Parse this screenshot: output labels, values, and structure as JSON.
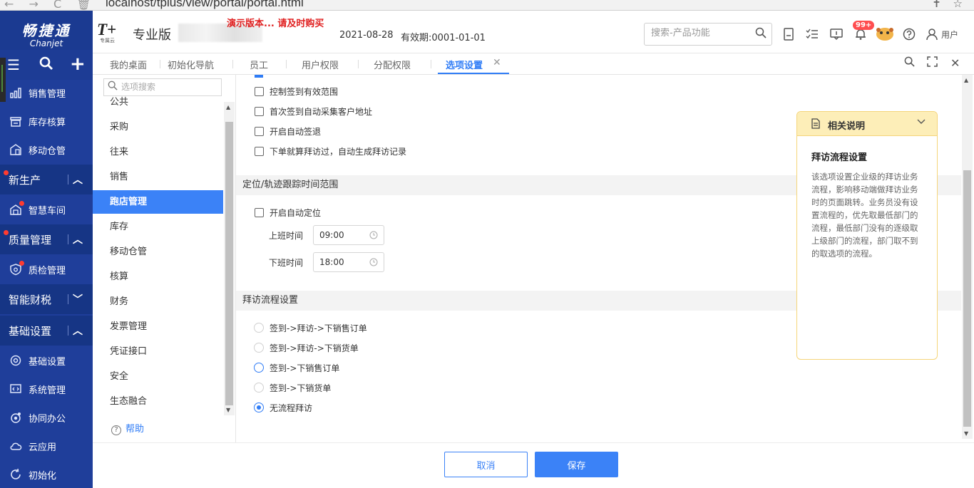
{
  "browser": {
    "url": "localhost/tplus/view/portal/portal.html"
  },
  "sidebar": {
    "logo_cn": "畅捷通",
    "logo_en": "Chanjet",
    "items": [
      {
        "label": "销售管理",
        "icon": "chart-icon"
      },
      {
        "label": "库存核算",
        "icon": "warehouse-icon"
      },
      {
        "label": "移动仓管",
        "icon": "mobile-warehouse-icon"
      },
      {
        "label": "新生产",
        "type": "group"
      },
      {
        "label": "智慧车间",
        "icon": "factory-icon"
      },
      {
        "label": "质量管理",
        "type": "group"
      },
      {
        "label": "质检管理",
        "icon": "shield-icon"
      },
      {
        "label": "智能财税",
        "type": "group"
      },
      {
        "label": "基础设置",
        "type": "group"
      },
      {
        "label": "基础设置",
        "icon": "gear-icon"
      },
      {
        "label": "系统管理",
        "icon": "code-icon"
      },
      {
        "label": "协同办公",
        "icon": "collab-icon"
      },
      {
        "label": "云应用",
        "icon": "cloud-icon"
      },
      {
        "label": "初始化",
        "icon": "refresh-icon"
      }
    ]
  },
  "header": {
    "product": "T+",
    "product_sub": "专属云",
    "edition": "专业版",
    "demo_warning": "演示版本... 请及时购买",
    "date": "2021-08-28",
    "validity": "有效期:0001-01-01",
    "search_placeholder": "搜索-产品功能",
    "badge": "99+",
    "user": "用户"
  },
  "tabs": [
    {
      "label": "我的桌面"
    },
    {
      "label": "初始化导航"
    },
    {
      "label": "员工"
    },
    {
      "label": "用户权限"
    },
    {
      "label": "分配权限"
    },
    {
      "label": "选项设置",
      "active": true
    }
  ],
  "options_nav": {
    "search_placeholder": "选项搜索",
    "items": [
      "公共",
      "采购",
      "往来",
      "销售",
      "跑店管理",
      "库存",
      "移动仓管",
      "核算",
      "财务",
      "发票管理",
      "凭证接口",
      "安全",
      "生态融合"
    ],
    "active": "跑店管理",
    "help": "帮助"
  },
  "content": {
    "checkboxes_top": [
      {
        "label": "控制签到有效范围",
        "checked": false
      },
      {
        "label": "首次签到自动采集客户地址",
        "checked": false
      },
      {
        "label": "开启自动签退",
        "checked": false
      },
      {
        "label": "下单就算拜访过，自动生成拜访记录",
        "checked": false
      }
    ],
    "section_location": "定位/轨迹跟踪时间范围",
    "auto_locate": {
      "label": "开启自动定位",
      "checked": false
    },
    "work_start": {
      "label": "上班时间",
      "value": "09:00"
    },
    "work_end": {
      "label": "下班时间",
      "value": "18:00"
    },
    "section_visit": "拜访流程设置",
    "visit_options": [
      {
        "label": "签到->拜访->下销售订单",
        "state": "unchecked"
      },
      {
        "label": "签到->拜访->下销货单",
        "state": "unchecked"
      },
      {
        "label": "签到->下销售订单",
        "state": "hover"
      },
      {
        "label": "签到->下销货单",
        "state": "unchecked"
      },
      {
        "label": "无流程拜访",
        "state": "checked"
      }
    ]
  },
  "explain": {
    "header": "相关说明",
    "title": "拜访流程设置",
    "body": "该选项设置企业级的拜访业务流程，影响移动端做拜访业务时的页面跳转。业务员没有设置流程的，优先取最低部门的流程，最低部门没有的逐级取上级部门的流程，部门取不到的取选项的流程。"
  },
  "footer": {
    "cancel": "取消",
    "save": "保存"
  },
  "colors": {
    "sidebar": "#1f3e9a",
    "accent": "#3b82f7",
    "explain_border": "#f5d57a",
    "explain_header": "#fdeeb8"
  }
}
